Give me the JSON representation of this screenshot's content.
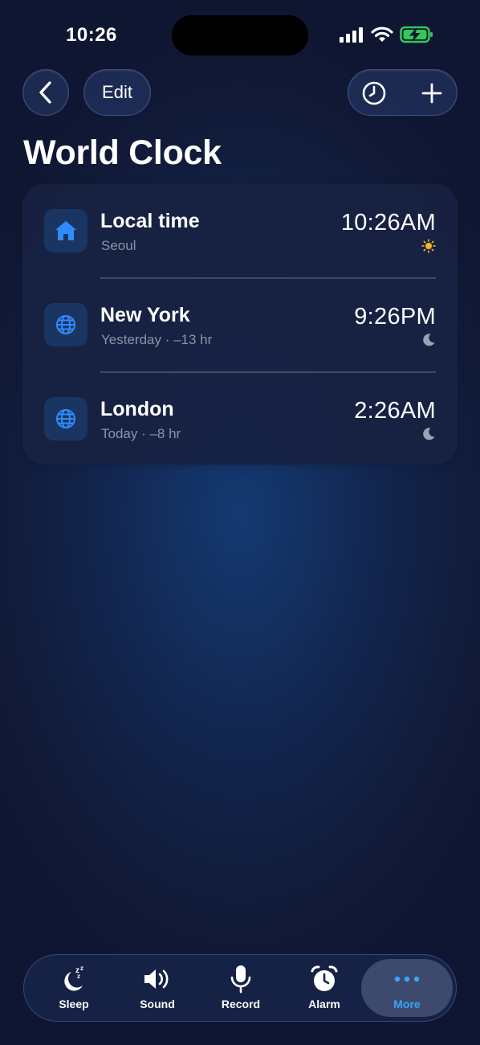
{
  "status_bar": {
    "time": "10:26"
  },
  "nav": {
    "back_icon": "chevron-left-icon",
    "edit_label": "Edit",
    "history_icon": "clock-icon",
    "add_icon": "plus-icon"
  },
  "page": {
    "title": "World Clock"
  },
  "clocks": [
    {
      "city": "Local time",
      "subtitle": "Seoul",
      "time": "10:26",
      "ampm": "AM",
      "icon": "home-icon",
      "daynight": "sun-icon"
    },
    {
      "city": "New York",
      "subtitle": "Yesterday · –13 hr",
      "time": "9:26",
      "ampm": "PM",
      "icon": "globe-icon",
      "daynight": "moon-icon"
    },
    {
      "city": "London",
      "subtitle": "Today · –8 hr",
      "time": "2:26",
      "ampm": "AM",
      "icon": "globe-icon",
      "daynight": "moon-icon"
    }
  ],
  "tabs": [
    {
      "label": "Sleep",
      "icon": "sleep-moon-icon",
      "active": false
    },
    {
      "label": "Sound",
      "icon": "speaker-icon",
      "active": false
    },
    {
      "label": "Record",
      "icon": "microphone-icon",
      "active": false
    },
    {
      "label": "Alarm",
      "icon": "alarm-clock-icon",
      "active": false
    },
    {
      "label": "More",
      "icon": "more-dots-icon",
      "active": true
    }
  ],
  "colors": {
    "accent_blue": "#3aa3ff",
    "icon_blue": "#2f8cff",
    "sun_yellow": "#f5b52a",
    "battery_green": "#34c759",
    "subtitle_gray": "#8c93a8"
  }
}
